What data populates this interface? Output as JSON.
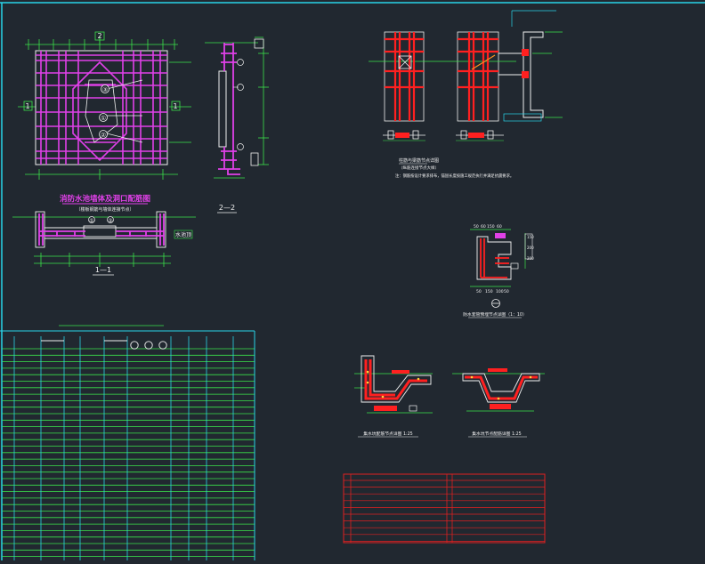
{
  "drawing": {
    "main_elevation_title": "消防水池墙体及洞口配筋图",
    "main_elevation_subtitle": "（楼板钢筋与墙体连接节点）",
    "section_1_1_label": "1—1",
    "section_2_2_label": "2—2",
    "main_label_2_top": "2",
    "main_label_1_left": "1",
    "main_label_1_right": "1",
    "marker_1": "①",
    "marker_2": "②",
    "marker_3": "③",
    "section_marker_1": "①",
    "section_marker_2": "②",
    "section_1_1_side": "水池顶",
    "detail_column_title": "柱筋与梁筋节点详图",
    "detail_column_sub": "（纵筋连接节点大样）",
    "detail_note": "注：钢筋按设计要求排布，锚固长度按施工规范执行并满足抗震要求。",
    "small_detail_title": "防水套管预埋节点详图（1：10）",
    "small_detail_dims_top": [
      "50",
      "60",
      "150",
      "60"
    ],
    "small_detail_dims_bottom": [
      "50",
      "150",
      "100",
      "50"
    ],
    "small_detail_side": [
      "150",
      "200",
      "200"
    ],
    "trench_left_title": "集水坑配筋节点详图 1:25",
    "trench_right_title": "集水坑节点配筋详图 1:25"
  },
  "colors": {
    "background": "#212830",
    "frame": "#29d4e8",
    "rebar_magenta": "#e040e8",
    "rebar_red": "#ff2020",
    "dim_green": "#3be34a",
    "white_line": "#f0f0f0",
    "table_grid": "#3be34a",
    "title_table_red": "#e02020"
  }
}
